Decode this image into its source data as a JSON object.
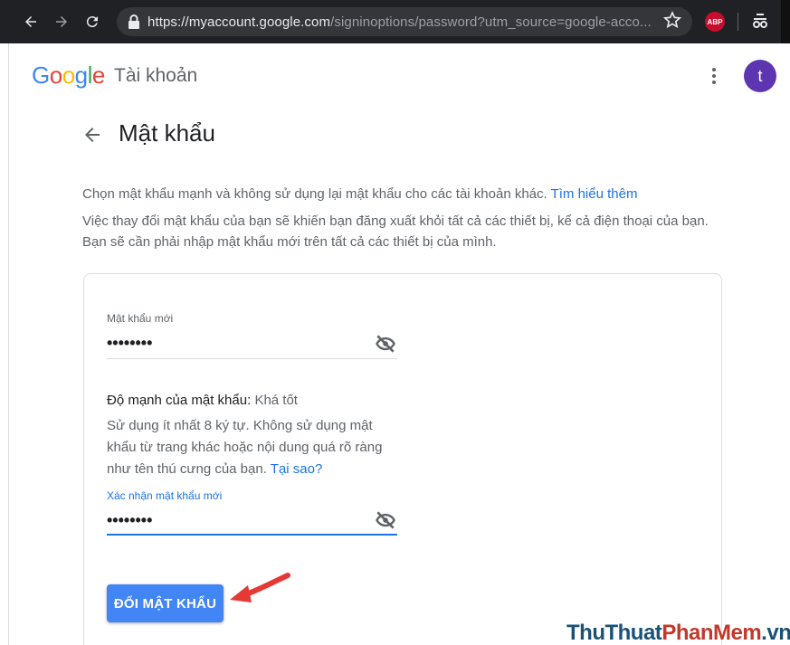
{
  "browser": {
    "url_main": "https://myaccount.google.com",
    "url_rest": "/signinoptions/password?utm_source=google-acco...",
    "extension_badge": "ABP"
  },
  "header": {
    "logo_letters": [
      "G",
      "o",
      "o",
      "g",
      "l",
      "e"
    ],
    "product_name": "Tài khoản",
    "avatar_initial": "t"
  },
  "page": {
    "title": "Mật khẩu",
    "intro_text": "Chọn mật khẩu mạnh và không sử dụng lại mật khẩu cho các tài khoản khác.",
    "learn_more_link": "Tìm hiểu thêm",
    "warning_text": "Việc thay đổi mật khẩu của bạn sẽ khiến bạn đăng xuất khỏi tất cả các thiết bị, kể cả điện thoại của bạn. Bạn sẽ cần phải nhập mật khẩu mới trên tất cả các thiết bị của mình."
  },
  "form": {
    "new_password_label": "Mật khẩu mới",
    "new_password_value": "••••••••",
    "strength_label": "Độ mạnh của mật khẩu:",
    "strength_value": "Khá tốt",
    "hint_text": "Sử dụng ít nhất 8 ký tự. Không sử dụng mật khẩu từ trang khác hoặc nội dung quá rõ ràng như tên thú cưng của bạn.",
    "why_link": "Tại sao?",
    "confirm_label": "Xác nhận mật khẩu mới",
    "confirm_value": "••••••••",
    "submit_label": "ĐỔI MẬT KHẨU"
  },
  "watermark": {
    "part1": "ThuThuat",
    "part2": "PhanMem",
    "part3": ".vn"
  },
  "colors": {
    "accent": "#1a73e8",
    "button": "#4285f4",
    "annotation_arrow": "#e53935",
    "avatar": "#5e35b1"
  }
}
